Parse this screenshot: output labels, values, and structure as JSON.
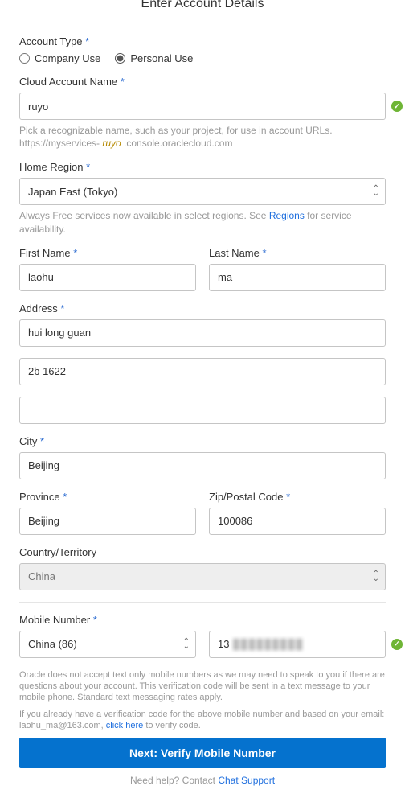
{
  "page": {
    "title": "Enter Account Details"
  },
  "accountType": {
    "label": "Account Type",
    "options": {
      "company": "Company Use",
      "personal": "Personal Use"
    },
    "selected": "personal"
  },
  "cloudAccount": {
    "label": "Cloud Account Name",
    "value": "ruyo",
    "helper_pre": "Pick a recognizable name, such as your project, for use in account URLs. https://myservices- ",
    "helper_em": "ruyo",
    "helper_post": " .console.oraclecloud.com"
  },
  "homeRegion": {
    "label": "Home Region",
    "value": "Japan East (Tokyo)",
    "helper_pre": "Always Free services now available in select regions. See ",
    "helper_link": "Regions",
    "helper_post": " for service availability."
  },
  "firstName": {
    "label": "First Name",
    "value": "laohu"
  },
  "lastName": {
    "label": "Last Name",
    "value": "ma"
  },
  "address": {
    "label": "Address",
    "line1": "hui long guan",
    "line2": "2b 1622",
    "line3": ""
  },
  "city": {
    "label": "City",
    "value": "Beijing"
  },
  "province": {
    "label": "Province",
    "value": "Beijing"
  },
  "zip": {
    "label": "Zip/Postal Code",
    "value": "100086"
  },
  "country": {
    "label": "Country/Territory",
    "value": "China"
  },
  "mobile": {
    "label": "Mobile Number",
    "countryCode": "China (86)",
    "numberPrefix": "13",
    "numberMasked": "█████████"
  },
  "notice1": "Oracle does not accept text only mobile numbers as we may need to speak to you if there are questions about your account. This verification code will be sent in a text message to your mobile phone. Standard text messaging rates apply.",
  "notice2_pre": "If you already have a verification code for the above mobile number and based on your email: laohu_ma@163.com, ",
  "notice2_link": "click here",
  "notice2_post": " to verify code.",
  "cta": "Next: Verify Mobile Number",
  "footer": {
    "pre": "Need help? Contact ",
    "link": "Chat Support"
  }
}
